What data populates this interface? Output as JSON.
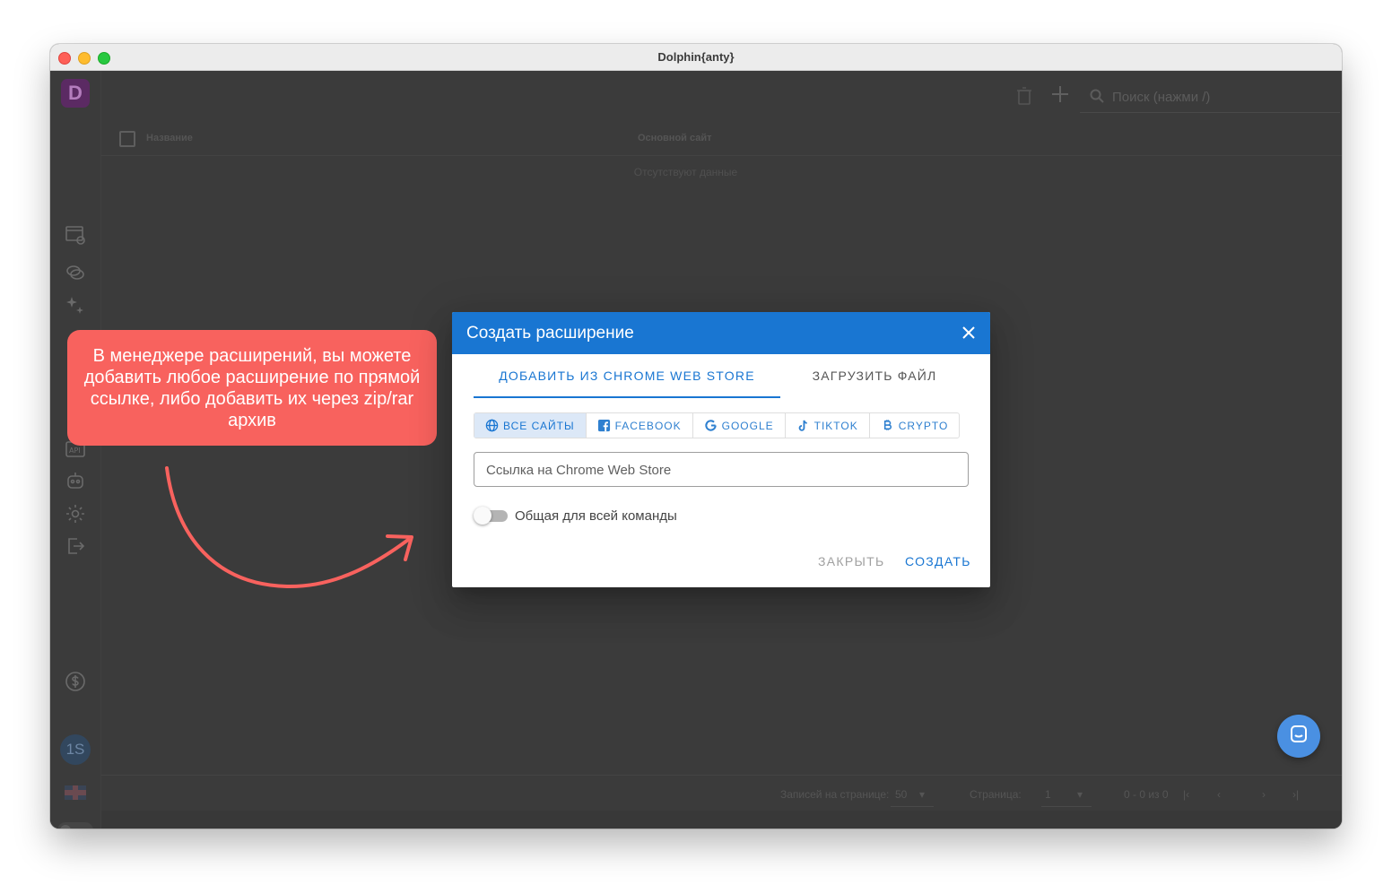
{
  "window": {
    "title": "Dolphin{anty}"
  },
  "sidebar": {
    "logo": "D",
    "avatar": "1S",
    "icons": [
      "browser-profiles-icon",
      "chat-icon",
      "sparkle-icon",
      "api-icon",
      "robot-icon",
      "gear-icon",
      "logout-icon",
      "dollar-icon"
    ]
  },
  "toolbar": {
    "search_placeholder": "Поиск (нажми /)"
  },
  "table": {
    "columns": [
      "Название",
      "Основной сайт"
    ],
    "empty": "Отсутствуют данные"
  },
  "pagination": {
    "rows_label": "Записей на странице:",
    "rows_value": "50",
    "page_label": "Страница:",
    "page_value": "1",
    "range": "0 - 0 из 0"
  },
  "callout": {
    "text": "В менеджере расширений, вы можете добавить любое расширение по прямой ссылке, либо добавить их через zip/rar архив",
    "color": "#f8625e"
  },
  "dialog": {
    "title": "Создать расширение",
    "tabs": [
      {
        "label": "ДОБАВИТЬ ИЗ CHROME WEB STORE",
        "active": true
      },
      {
        "label": "ЗАГРУЗИТЬ ФАЙЛ",
        "active": false
      }
    ],
    "chips": [
      {
        "label": "ВСЕ САЙТЫ",
        "icon": "globe-icon",
        "active": true
      },
      {
        "label": "FACEBOOK",
        "icon": "facebook-icon",
        "active": false
      },
      {
        "label": "GOOGLE",
        "icon": "google-icon",
        "active": false
      },
      {
        "label": "TIKTOK",
        "icon": "tiktok-icon",
        "active": false
      },
      {
        "label": "CRYPTO",
        "icon": "bitcoin-icon",
        "active": false
      }
    ],
    "link_placeholder": "Ссылка на Chrome Web Store",
    "link_value": "",
    "share_label": "Общая для всей команды",
    "share_enabled": false,
    "close_label": "ЗАКРЫТЬ",
    "create_label": "СОЗДАТЬ",
    "accent": "#1976d2"
  }
}
